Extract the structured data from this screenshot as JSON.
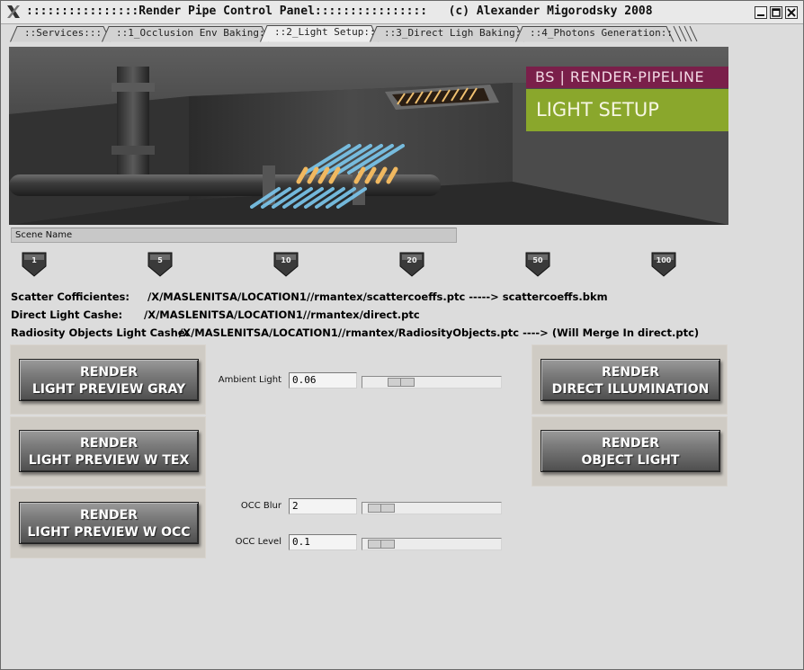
{
  "window": {
    "title": "::::::::::::::::Render Pipe Control Panel::::::::::::::::   (c) Alexander Migorodsky 2008"
  },
  "tabs": [
    {
      "label": "::Services:::"
    },
    {
      "label": "::1_Occlusion Env Baking::"
    },
    {
      "label": "::2_Light Setup::",
      "active": true
    },
    {
      "label": "::3_Direct Ligh Baking::"
    },
    {
      "label": "::4_Photons Generation::"
    }
  ],
  "banner": {
    "brand": "BS | RENDER-PIPELINE",
    "section": "LIGHT SETUP",
    "brand_color": "#7a1f4a",
    "section_color": "#8aa72c"
  },
  "scene": {
    "label": "Scene Name"
  },
  "shelf": {
    "buttons": [
      "1",
      "5",
      "10",
      "20",
      "50",
      "100"
    ]
  },
  "paths": [
    {
      "label": "Scatter Cofficientes:",
      "value": "/X/MASLENITSA/LOCATION1//rmantex/scattercoeffs.ptc -----> scattercoeffs.bkm"
    },
    {
      "label": "Direct Light Cashe:",
      "value": "/X/MASLENITSA/LOCATION1//rmantex/direct.ptc"
    },
    {
      "label": "Radiosity Objects Light Cashe:",
      "value": "/X/MASLENITSA/LOCATION1//rmantex/RadiosityObjects.ptc ----> (Will Merge In direct.ptc)"
    }
  ],
  "render_buttons": {
    "preview_gray": {
      "line1": "RENDER",
      "line2": "LIGHT PREVIEW GRAY"
    },
    "preview_tex": {
      "line1": "RENDER",
      "line2": "LIGHT PREVIEW W TEX"
    },
    "preview_occ": {
      "line1": "RENDER",
      "line2": "LIGHT PREVIEW W OCC"
    },
    "direct_illum": {
      "line1": "RENDER",
      "line2": "DIRECT ILLUMINATION"
    },
    "object_light": {
      "line1": "RENDER",
      "line2": "OBJECT LIGHT"
    }
  },
  "sliders": {
    "ambient": {
      "label": "Ambient Light",
      "value": "0.06"
    },
    "occ_blur": {
      "label": "OCC Blur",
      "value": "2"
    },
    "occ_level": {
      "label": "OCC Level",
      "value": "0.1"
    }
  }
}
